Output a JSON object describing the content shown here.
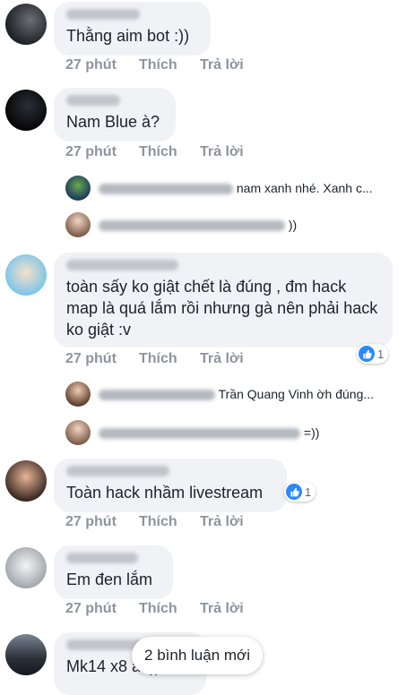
{
  "comments": [
    {
      "text": "Thằng aim bot :))",
      "time": "27 phút",
      "like": "Thích",
      "reply": "Trả lời"
    },
    {
      "text": "Nam Blue à?",
      "time": "27 phút",
      "like": "Thích",
      "reply": "Trả lời",
      "replies": [
        {
          "preview": "nam xanh nhé. Xanh c..."
        },
        {
          "preview": "))"
        }
      ]
    },
    {
      "text": "toàn sấy ko giật chết là đúng , đm hack map là quá lắm rồi nhưng gà nên phải hack ko giật :v",
      "time": "27 phút",
      "like": "Thích",
      "reply": "Trả lời",
      "reactions": "1",
      "replies": [
        {
          "preview": "Trần Quang Vinh ờh đúng..."
        },
        {
          "preview": "=))"
        }
      ]
    },
    {
      "text": "Toàn hack nhầm livestream",
      "time": "27 phút",
      "like": "Thích",
      "reply": "Trả lời",
      "reactions": "1"
    },
    {
      "text": "Em đen lắm",
      "time": "27 phút",
      "like": "Thích",
      "reply": "Trả lời"
    },
    {
      "text": "Mk14 x8 à :))"
    }
  ],
  "new_comments_pill": "2 bình luận mới",
  "colors": {
    "bubble": "#f1f2f6",
    "meta": "#8d949e",
    "like_blue": "#2d88ff"
  }
}
